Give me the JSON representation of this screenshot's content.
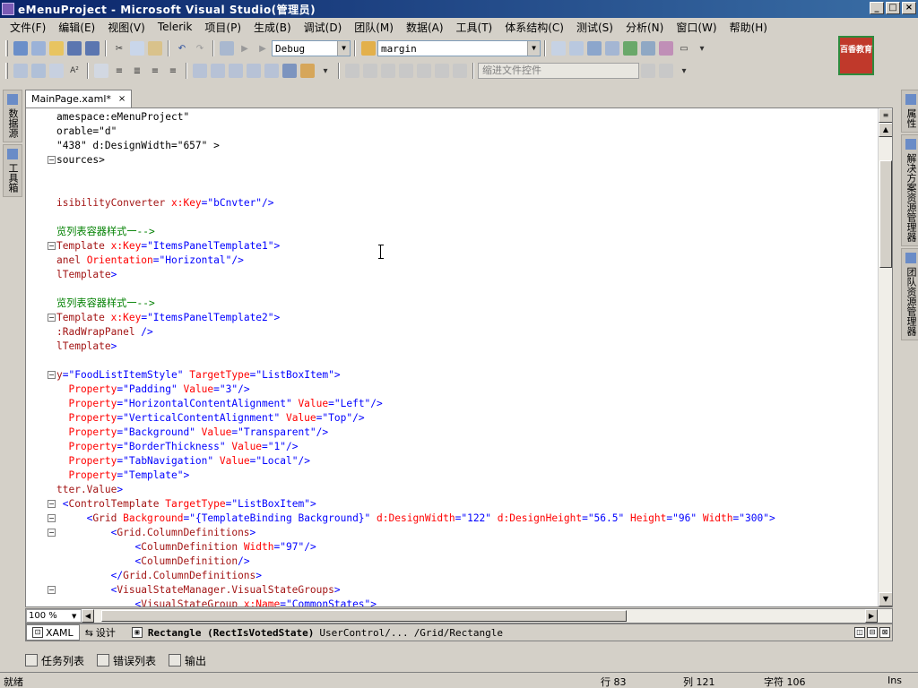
{
  "window": {
    "title": "eMenuProject - Microsoft Visual Studio(管理员)",
    "min": "_",
    "max": "□",
    "close": "×"
  },
  "menu": [
    "文件(F)",
    "编辑(E)",
    "视图(V)",
    "Telerik",
    "项目(P)",
    "生成(B)",
    "调试(D)",
    "团队(M)",
    "数据(A)",
    "工具(T)",
    "体系结构(C)",
    "测试(S)",
    "分析(N)",
    "窗口(W)",
    "帮助(H)"
  ],
  "toolbar": {
    "config": "Debug",
    "find": "margin",
    "find_in_files_placeholder": "缩进文件控件"
  },
  "logo": {
    "text": "百香教育"
  },
  "left_tabs": [
    "数据源",
    "工具箱"
  ],
  "right_tabs": [
    "属性",
    "解决方案资源管理器",
    "团队资源管理器"
  ],
  "document": {
    "tab": "MainPage.xaml*",
    "close": "×"
  },
  "code": [
    [
      [
        "t-tx",
        "amespace:eMenuProject\""
      ]
    ],
    [
      [
        "t-tx",
        "orable=\"d\""
      ]
    ],
    [
      [
        "t-tx",
        "\"438\" d:DesignWidth=\"657\" >"
      ]
    ],
    [
      [
        "t-tx",
        "sources>"
      ]
    ],
    [
      [
        "t-tx",
        ""
      ]
    ],
    [
      [
        "t-tx",
        ""
      ]
    ],
    [
      [
        "t-el",
        "isibilityConverter "
      ],
      [
        "t-at",
        "x:Key"
      ],
      [
        "t-p",
        "="
      ],
      [
        "t-v",
        "\"bCnvter\""
      ],
      [
        "t-p",
        "/>"
      ]
    ],
    [
      [
        "t-tx",
        ""
      ]
    ],
    [
      [
        "t-cm",
        "览列表容器样式一-->"
      ]
    ],
    [
      [
        "t-el",
        "Template "
      ],
      [
        "t-at",
        "x:Key"
      ],
      [
        "t-p",
        "="
      ],
      [
        "t-v",
        "\"ItemsPanelTemplate1\""
      ],
      [
        "t-p",
        ">"
      ]
    ],
    [
      [
        "t-el",
        "anel "
      ],
      [
        "t-at",
        "Orientation"
      ],
      [
        "t-p",
        "="
      ],
      [
        "t-v",
        "\"Horizontal\""
      ],
      [
        "t-p",
        "/>"
      ]
    ],
    [
      [
        "t-el",
        "lTemplate"
      ],
      [
        "t-p",
        ">"
      ]
    ],
    [
      [
        "t-tx",
        ""
      ]
    ],
    [
      [
        "t-cm",
        "览列表容器样式一-->"
      ]
    ],
    [
      [
        "t-el",
        "Template "
      ],
      [
        "t-at",
        "x:Key"
      ],
      [
        "t-p",
        "="
      ],
      [
        "t-v",
        "\"ItemsPanelTemplate2\""
      ],
      [
        "t-p",
        ">"
      ]
    ],
    [
      [
        "t-el",
        ":RadWrapPanel "
      ],
      [
        "t-p",
        "/>"
      ]
    ],
    [
      [
        "t-el",
        "lTemplate"
      ],
      [
        "t-p",
        ">"
      ]
    ],
    [
      [
        "t-tx",
        ""
      ]
    ],
    [
      [
        "t-el",
        "y"
      ],
      [
        "t-p",
        "="
      ],
      [
        "t-v",
        "\"FoodListItemStyle\" "
      ],
      [
        "t-at",
        "TargetType"
      ],
      [
        "t-p",
        "="
      ],
      [
        "t-v",
        "\"ListBoxItem\""
      ],
      [
        "t-p",
        ">"
      ]
    ],
    [
      [
        "t-at",
        "  Property"
      ],
      [
        "t-p",
        "="
      ],
      [
        "t-v",
        "\"Padding\" "
      ],
      [
        "t-at",
        "Value"
      ],
      [
        "t-p",
        "="
      ],
      [
        "t-v",
        "\"3\""
      ],
      [
        "t-p",
        "/>"
      ]
    ],
    [
      [
        "t-at",
        "  Property"
      ],
      [
        "t-p",
        "="
      ],
      [
        "t-v",
        "\"HorizontalContentAlignment\" "
      ],
      [
        "t-at",
        "Value"
      ],
      [
        "t-p",
        "="
      ],
      [
        "t-v",
        "\"Left\""
      ],
      [
        "t-p",
        "/>"
      ]
    ],
    [
      [
        "t-at",
        "  Property"
      ],
      [
        "t-p",
        "="
      ],
      [
        "t-v",
        "\"VerticalContentAlignment\" "
      ],
      [
        "t-at",
        "Value"
      ],
      [
        "t-p",
        "="
      ],
      [
        "t-v",
        "\"Top\""
      ],
      [
        "t-p",
        "/>"
      ]
    ],
    [
      [
        "t-at",
        "  Property"
      ],
      [
        "t-p",
        "="
      ],
      [
        "t-v",
        "\"Background\" "
      ],
      [
        "t-at",
        "Value"
      ],
      [
        "t-p",
        "="
      ],
      [
        "t-v",
        "\"Transparent\""
      ],
      [
        "t-p",
        "/>"
      ]
    ],
    [
      [
        "t-at",
        "  Property"
      ],
      [
        "t-p",
        "="
      ],
      [
        "t-v",
        "\"BorderThickness\" "
      ],
      [
        "t-at",
        "Value"
      ],
      [
        "t-p",
        "="
      ],
      [
        "t-v",
        "\"1\""
      ],
      [
        "t-p",
        "/>"
      ]
    ],
    [
      [
        "t-at",
        "  Property"
      ],
      [
        "t-p",
        "="
      ],
      [
        "t-v",
        "\"TabNavigation\" "
      ],
      [
        "t-at",
        "Value"
      ],
      [
        "t-p",
        "="
      ],
      [
        "t-v",
        "\"Local\""
      ],
      [
        "t-p",
        "/>"
      ]
    ],
    [
      [
        "t-at",
        "  Property"
      ],
      [
        "t-p",
        "="
      ],
      [
        "t-v",
        "\"Template\""
      ],
      [
        "t-p",
        ">"
      ]
    ],
    [
      [
        "t-el",
        "tter.Value"
      ],
      [
        "t-p",
        ">"
      ]
    ],
    [
      [
        "t-p",
        " <"
      ],
      [
        "t-el",
        "ControlTemplate "
      ],
      [
        "t-at",
        "TargetType"
      ],
      [
        "t-p",
        "="
      ],
      [
        "t-v",
        "\"ListBoxItem\""
      ],
      [
        "t-p",
        ">"
      ]
    ],
    [
      [
        "t-p",
        "     <"
      ],
      [
        "t-el",
        "Grid "
      ],
      [
        "t-at",
        "Background"
      ],
      [
        "t-p",
        "="
      ],
      [
        "t-v",
        "\"{TemplateBinding Background}\" "
      ],
      [
        "t-at",
        "d:DesignWidth"
      ],
      [
        "t-p",
        "="
      ],
      [
        "t-v",
        "\"122\" "
      ],
      [
        "t-at",
        "d:DesignHeight"
      ],
      [
        "t-p",
        "="
      ],
      [
        "t-v",
        "\"56.5\" "
      ],
      [
        "t-at",
        "Height"
      ],
      [
        "t-p",
        "="
      ],
      [
        "t-v",
        "\"96\" "
      ],
      [
        "t-at",
        "Width"
      ],
      [
        "t-p",
        "="
      ],
      [
        "t-v",
        "\"300\""
      ],
      [
        "t-p",
        ">"
      ]
    ],
    [
      [
        "t-p",
        "         <"
      ],
      [
        "t-el",
        "Grid.ColumnDefinitions"
      ],
      [
        "t-p",
        ">"
      ]
    ],
    [
      [
        "t-p",
        "             <"
      ],
      [
        "t-el",
        "ColumnDefinition "
      ],
      [
        "t-at",
        "Width"
      ],
      [
        "t-p",
        "="
      ],
      [
        "t-v",
        "\"97\""
      ],
      [
        "t-p",
        "/>"
      ]
    ],
    [
      [
        "t-p",
        "             <"
      ],
      [
        "t-el",
        "ColumnDefinition"
      ],
      [
        "t-p",
        "/>"
      ]
    ],
    [
      [
        "t-p",
        "         </"
      ],
      [
        "t-el",
        "Grid.ColumnDefinitions"
      ],
      [
        "t-p",
        ">"
      ]
    ],
    [
      [
        "t-p",
        "         <"
      ],
      [
        "t-el",
        "VisualStateManager.VisualStateGroups"
      ],
      [
        "t-p",
        ">"
      ]
    ],
    [
      [
        "t-p",
        "             <"
      ],
      [
        "t-el",
        "VisualStateGroup "
      ],
      [
        "t-at",
        "x:Name"
      ],
      [
        "t-p",
        "="
      ],
      [
        "t-v",
        "\"CommonStates\""
      ],
      [
        "t-p",
        ">"
      ]
    ]
  ],
  "fold_lines": [
    3,
    9,
    14,
    18,
    27,
    28,
    29,
    33
  ],
  "view": {
    "zoom": "100 %",
    "xaml_tab": "XAML",
    "design_tab": "设计"
  },
  "breadcrumb": {
    "element": "Rectangle (RectIsVotedState)",
    "path1": "UserControl/...",
    "path2": "/Grid/Rectangle"
  },
  "output_tabs": [
    "任务列表",
    "错误列表",
    "输出"
  ],
  "status": {
    "ready": "就绪",
    "row": "行 83",
    "col": "列 121",
    "ch": "字符 106",
    "mode": "Ins"
  }
}
